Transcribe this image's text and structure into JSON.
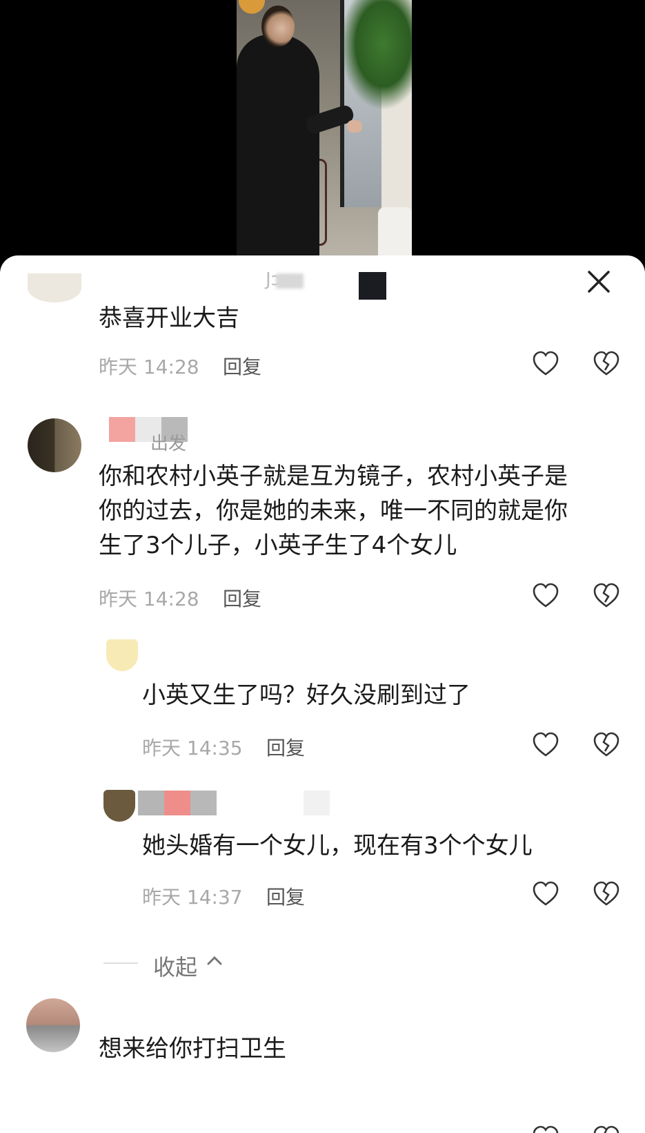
{
  "sheet": {
    "title": "Jɔɔ.."
  },
  "comments": [
    {
      "text": "恭喜开业大吉",
      "time": "昨天 14:28",
      "reply_label": "回复"
    },
    {
      "username": "出发",
      "text_lines": [
        "你和农村小英子就是互为镜子，农村小英子是",
        "你的过去，你是她的未来，唯一不同的就是你",
        "生了3个儿子，小英子生了4个女儿"
      ],
      "time": "昨天 14:28",
      "reply_label": "回复"
    },
    {
      "text": "小英又生了吗？好久没刷到过了",
      "time": "昨天 14:35",
      "reply_label": "回复"
    },
    {
      "text": "她头婚有一个女儿，现在有3个个女儿",
      "time": "昨天 14:37",
      "reply_label": "回复"
    },
    {
      "text": "想来给你打扫卫生"
    }
  ],
  "collapse_label": "收起",
  "icons": {
    "close": "close-icon",
    "like": "heart-icon",
    "dislike": "broken-heart-icon",
    "collapse": "chevron-up-icon"
  },
  "colors": {
    "text_primary": "#1a1a1a",
    "meta": "#a8a8a8"
  }
}
